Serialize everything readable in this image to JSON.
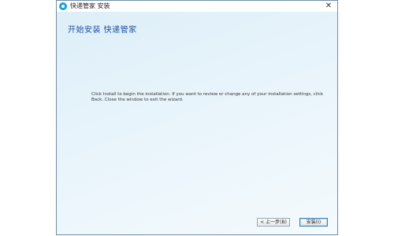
{
  "window": {
    "title": "快递管家 安装"
  },
  "main": {
    "heading": "开始安装 快递管家",
    "body": "Click Install to begin the installation. If you want to review or change any of your installation settings, click Back. Close the window to exit the wizard."
  },
  "buttons": {
    "back_label": "< 上一步(B)",
    "install_label": "安装(I)"
  },
  "colors": {
    "heading": "#1e4fa3",
    "background_top": "#dceef8",
    "background_bottom": "#f4fafd"
  },
  "icons": {
    "app": "app-logo-icon",
    "close": "close-icon"
  }
}
